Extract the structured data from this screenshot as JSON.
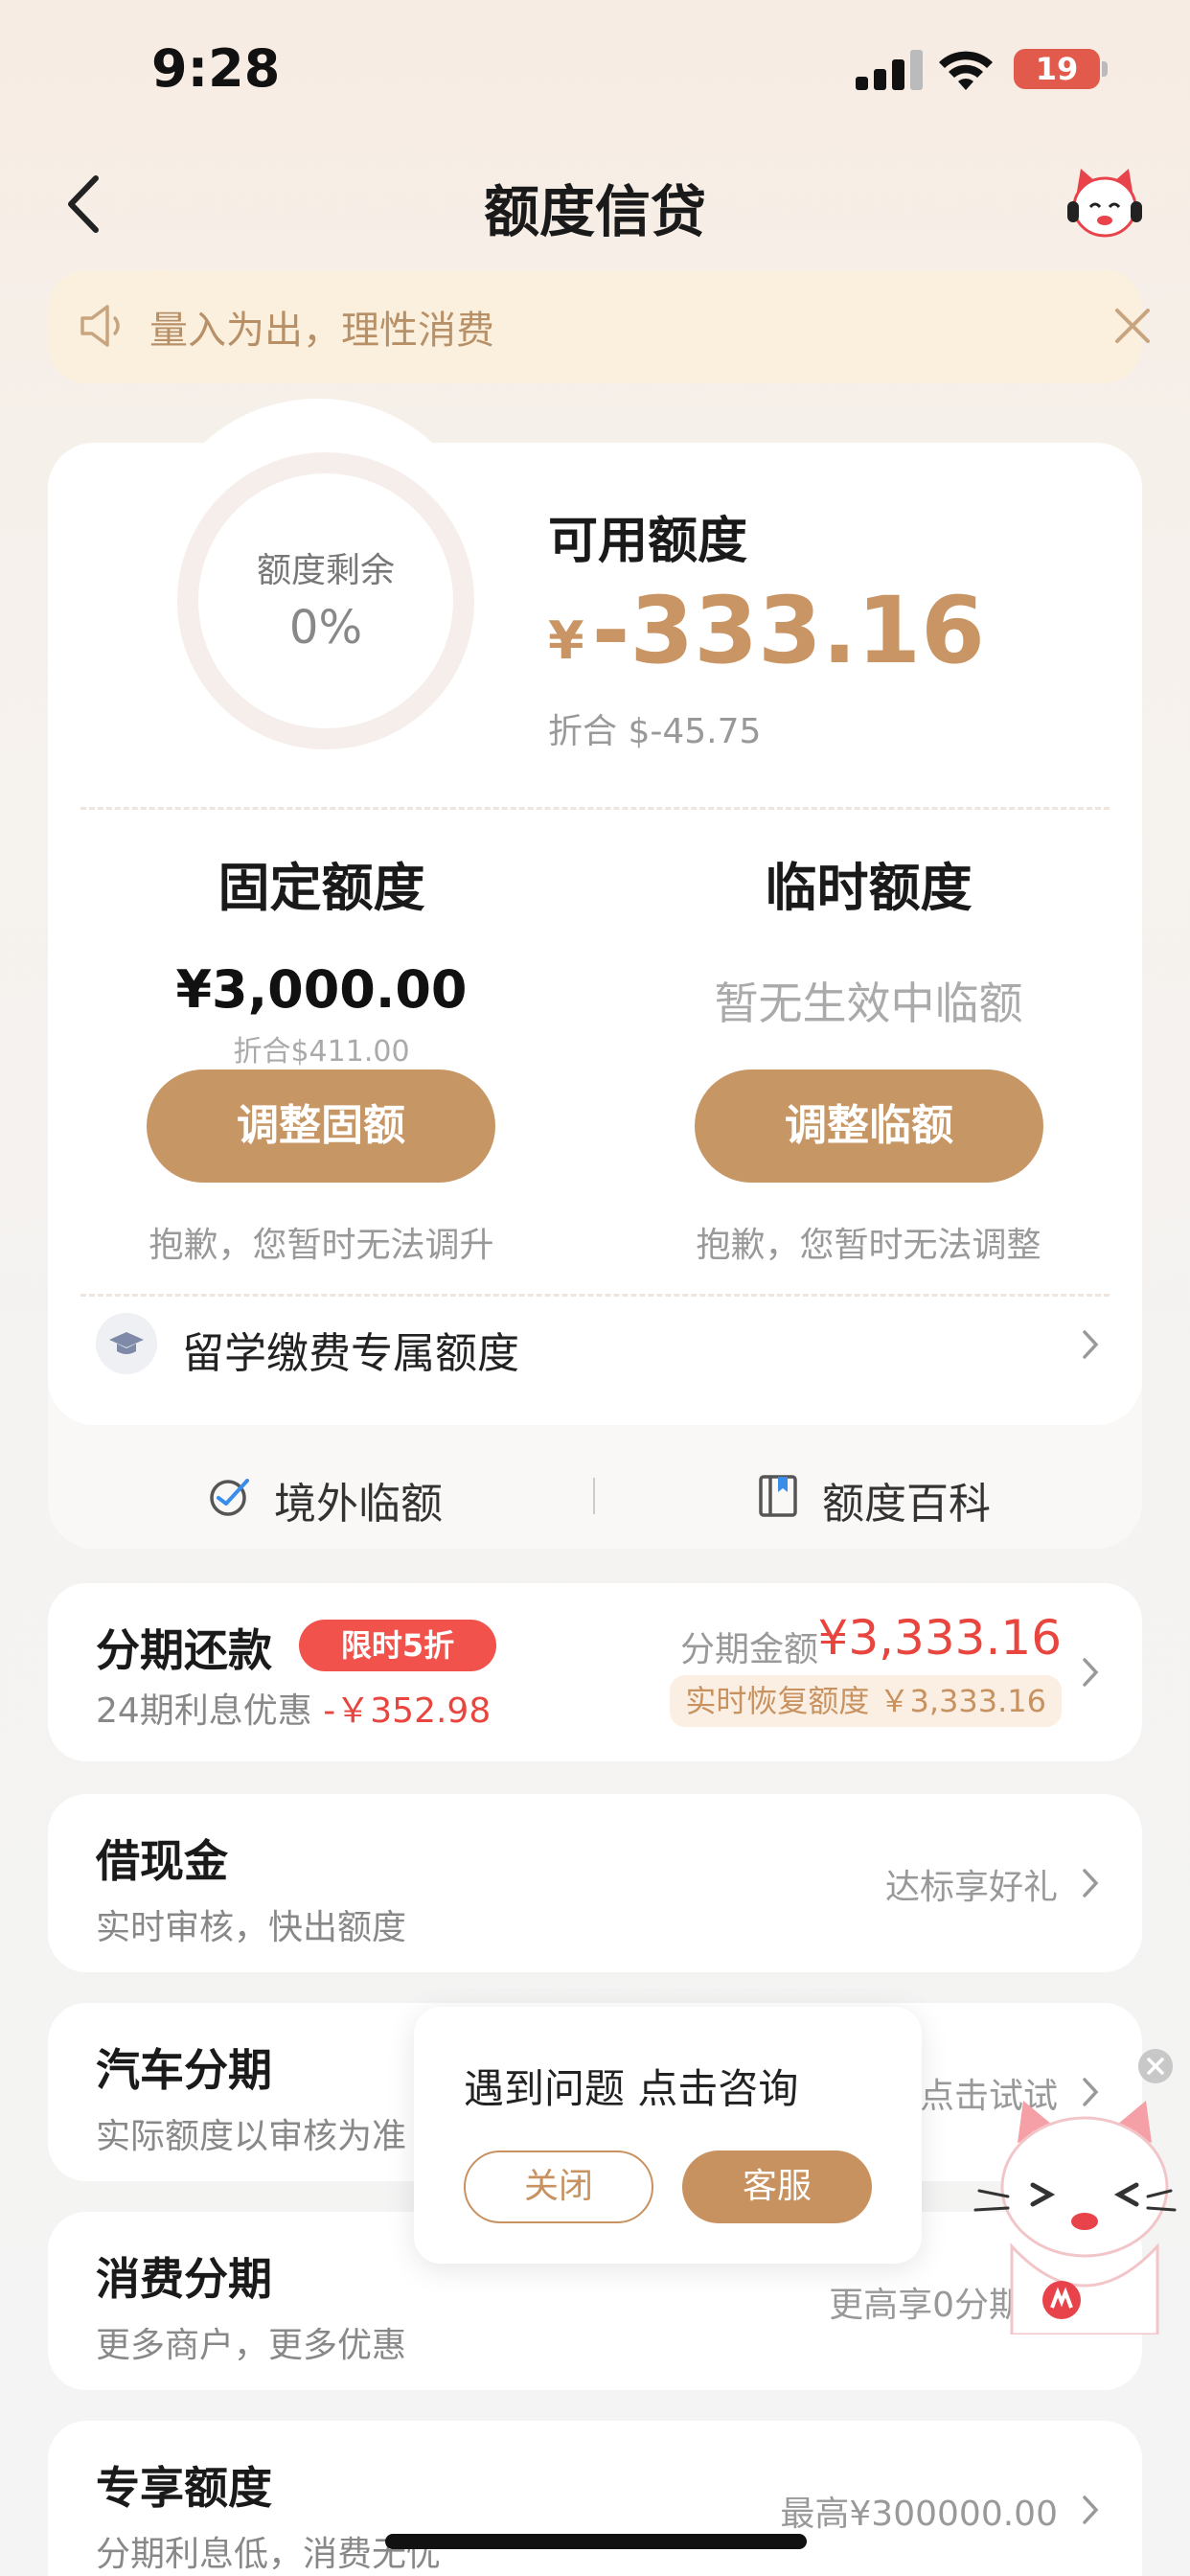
{
  "status_bar": {
    "time": "9:28",
    "battery": "19"
  },
  "header": {
    "title": "额度信贷"
  },
  "notice": {
    "text": "量入为出，理性消费"
  },
  "quota": {
    "ring_label": "额度剩余",
    "ring_value": "0%",
    "remaining_fraction": 0,
    "available_label": "可用额度",
    "currency": "¥",
    "available_amount": "-333.16",
    "available_sub": "折合 $-45.75",
    "fixed": {
      "title": "固定额度",
      "amount": "¥3,000.00",
      "sub": "折合$411.00",
      "button": "调整固额",
      "note": "抱歉，您暂时无法调升"
    },
    "temporary": {
      "title": "临时额度",
      "empty_text": "暂无生效中临额",
      "button": "调整临额",
      "note": "抱歉，您暂时无法调整"
    },
    "study_label": "留学缴费专属额度",
    "link_overseas": "境外临额",
    "link_wiki": "额度百科"
  },
  "installment": {
    "title": "分期还款",
    "promo": "限时5折",
    "sub_prefix": "24期利息优惠",
    "sub_discount": "-￥352.98",
    "amount_label": "分期金额",
    "amount": "¥3,333.16",
    "recover": "实时恢复额度 ￥3,333.16"
  },
  "cards": [
    {
      "title": "借现金",
      "sub": "实时审核，快出额度",
      "right": "达标享好礼"
    },
    {
      "title": "汽车分期",
      "sub": "实际额度以审核为准",
      "right": "点击试试"
    },
    {
      "title": "消费分期",
      "sub": "更多商户，更多优惠",
      "right": "更高享0分期利"
    },
    {
      "title": "专享额度",
      "sub": "分期利息低，消费无忧",
      "right": "最高¥300000.00"
    }
  ],
  "popup": {
    "text": "遇到问题 点击咨询",
    "close_label": "关闭",
    "service_label": "客服"
  },
  "colors": {
    "accent": "#c79665",
    "red": "#e9453f",
    "notice_bg": "#fbf0de"
  }
}
